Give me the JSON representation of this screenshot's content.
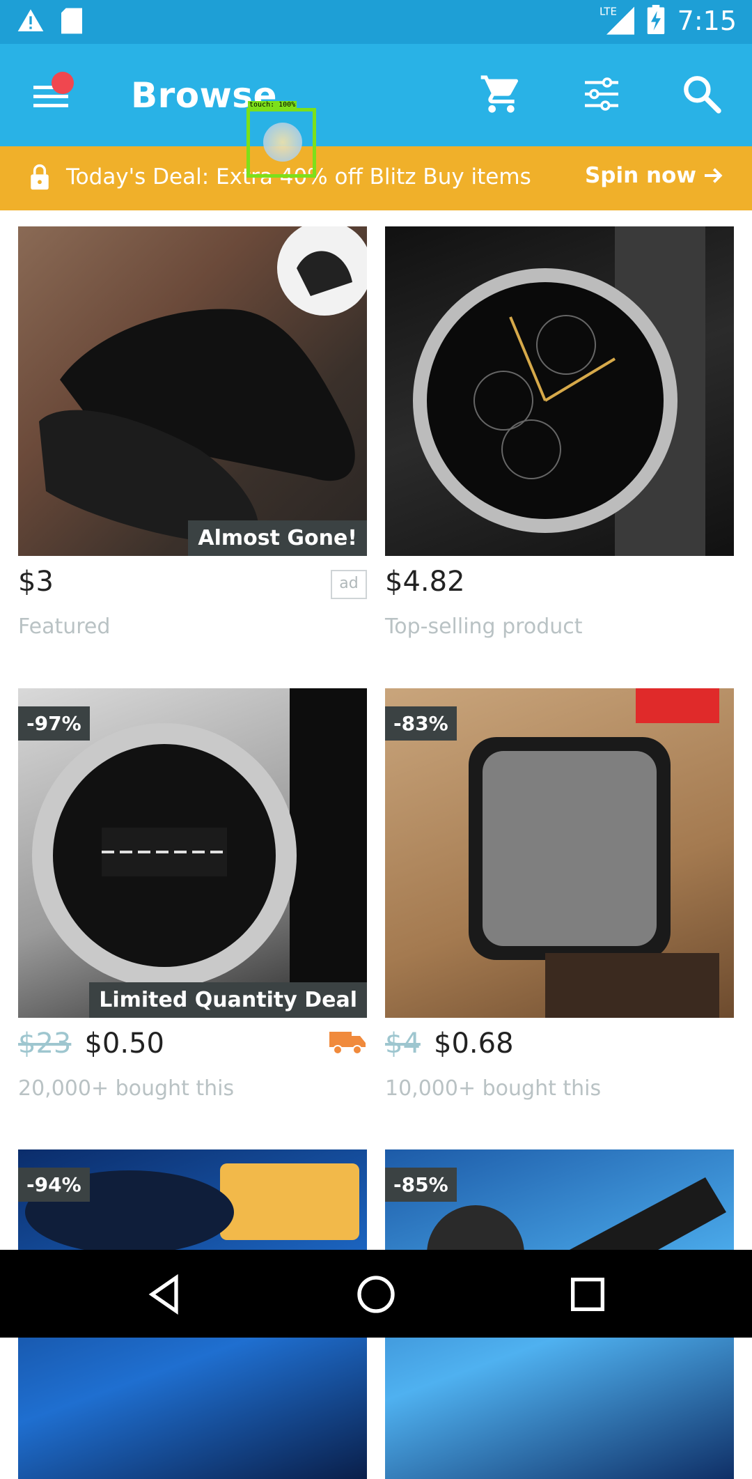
{
  "status_bar": {
    "time": "7:15",
    "network": "LTE"
  },
  "app_bar": {
    "title": "Browse"
  },
  "deal_banner": {
    "text": "Today's Deal: Extra 40% off Blitz Buy items",
    "cta": "Spin now"
  },
  "products": [
    {
      "badge": "Almost Gone!",
      "price": "$3",
      "subtitle": "Featured",
      "ad_label": "ad"
    },
    {
      "price": "$4.82",
      "subtitle": "Top-selling product"
    },
    {
      "discount": "-97%",
      "badge": "Limited Quantity Deal",
      "old_price": "$23",
      "price": "$0.50",
      "subtitle": "20,000+ bought this"
    },
    {
      "discount": "-83%",
      "old_price": "$4",
      "price": "$0.68",
      "subtitle": "10,000+ bought this"
    },
    {
      "discount": "-94%"
    },
    {
      "discount": "-85%"
    }
  ],
  "touch_overlay": {
    "label": "touch: 100%"
  },
  "colors": {
    "status_bar": "#1e9fd6",
    "app_bar": "#29b2e6",
    "deal_banner": "#f0b02a",
    "badge": "#3b4243"
  }
}
